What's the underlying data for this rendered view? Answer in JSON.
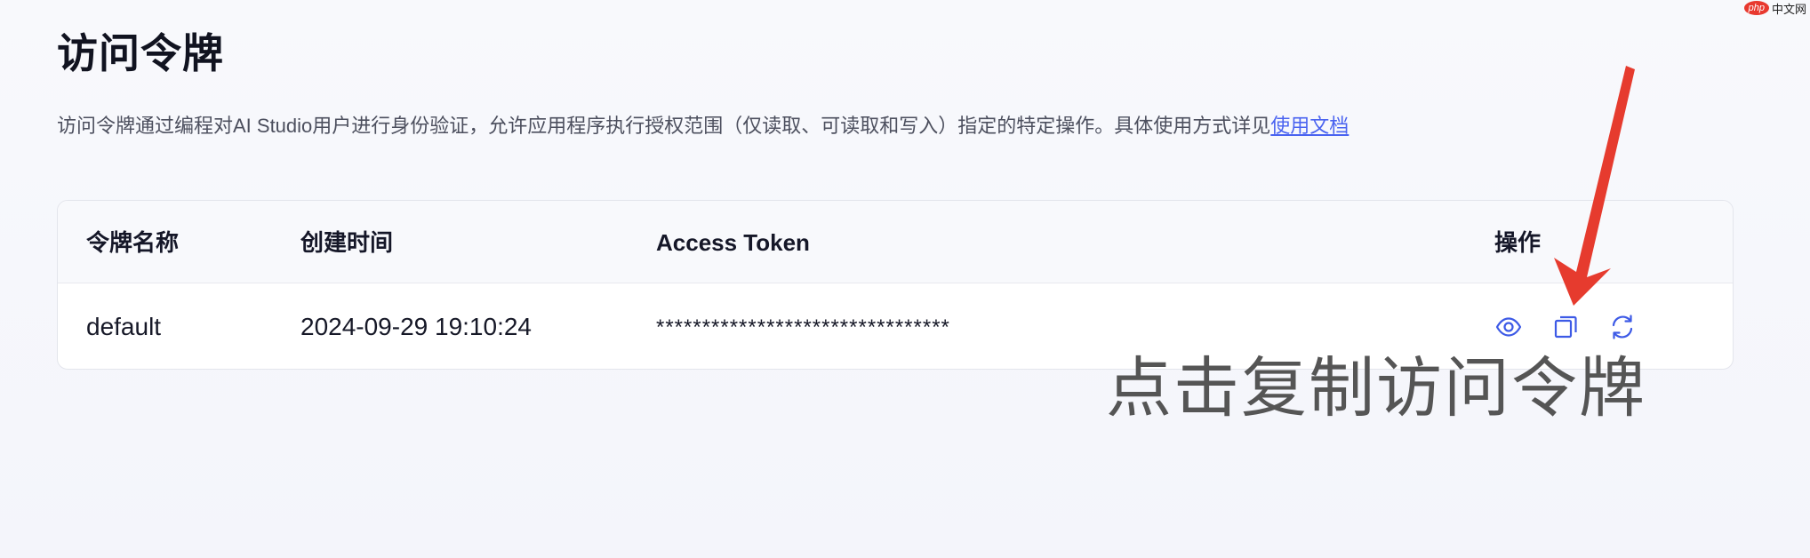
{
  "page": {
    "title": "访问令牌",
    "description": "访问令牌通过编程对AI Studio用户进行身份验证，允许应用程序执行授权范围（仅读取、可读取和写入）指定的特定操作。具体使用方式详见",
    "docs_link": "使用文档"
  },
  "table": {
    "headers": {
      "name": "令牌名称",
      "created": "创建时间",
      "token": "Access Token",
      "actions": "操作"
    },
    "rows": [
      {
        "name": "default",
        "created": "2024-09-29 19:10:24",
        "token": "********************************",
        "actions": [
          "eye-icon",
          "copy-icon",
          "refresh-icon"
        ]
      }
    ]
  },
  "annotation": {
    "text": "点击复制访问令牌",
    "arrow_color": "#e63b2e"
  },
  "watermark": {
    "badge": "php",
    "text": "中文网"
  },
  "colors": {
    "accent": "#4a63f0",
    "icon": "#3d5ae6",
    "arrow": "#e63b2e"
  }
}
